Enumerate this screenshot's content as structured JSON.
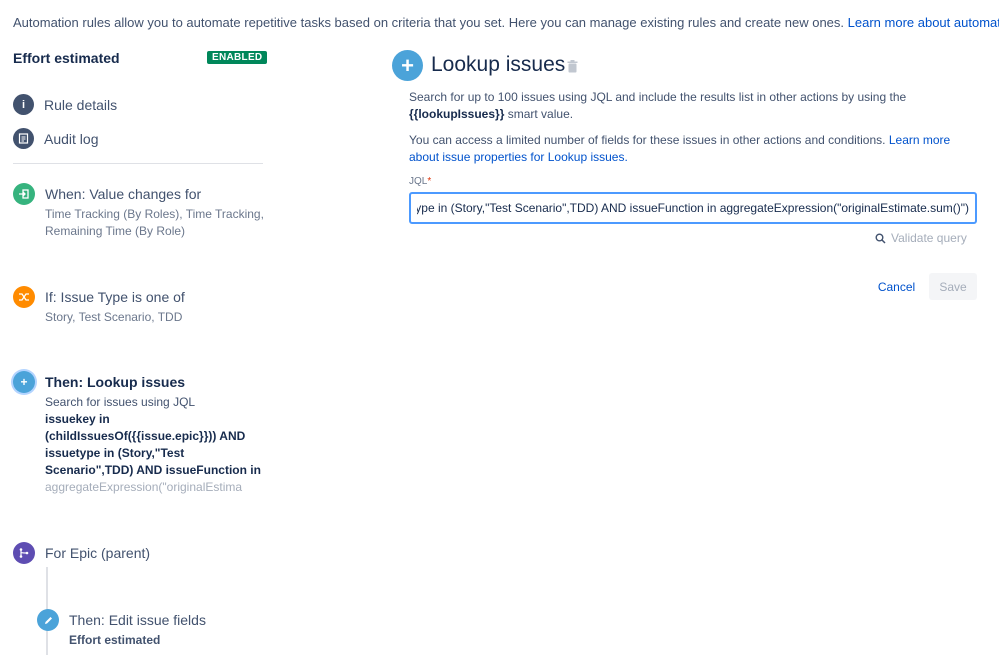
{
  "intro": {
    "text": "Automation rules allow you to automate repetitive tasks based on criteria that you set. Here you can manage existing rules and create new ones.",
    "link": "Learn more about automation"
  },
  "rule": {
    "name": "Effort estimated",
    "status": "ENABLED"
  },
  "nav": [
    {
      "label": "Rule details",
      "icon": "info-icon"
    },
    {
      "label": "Audit log",
      "icon": "list-icon"
    }
  ],
  "steps": {
    "trigger": {
      "title": "When: Value changes for",
      "desc": "Time Tracking (By Roles), Time Tracking, Remaining Time (By Role)",
      "color": "#36b37e"
    },
    "condition": {
      "title": "If: Issue Type is one of",
      "desc": "Story, Test Scenario, TDD",
      "color": "#ff8b00"
    },
    "action": {
      "title": "Then: Lookup issues",
      "desc": "Search for issues using JQL",
      "jql_preview": "issuekey in (childIssuesOf({{issue.epic}})) AND issuetype in (Story,\"Test Scenario\",TDD) AND issueFunction in",
      "jql_fade": "aggregateExpression(\"originalEstima",
      "color": "#4ba3d9"
    },
    "branch": {
      "title": "For Epic (parent)",
      "color": "#5e4db2"
    },
    "edit": {
      "title": "Then: Edit issue fields",
      "desc": "Effort estimated",
      "color": "#4ba3d9"
    }
  },
  "panel": {
    "title": "Lookup issues",
    "desc1_pre": "Search for up to 100 issues using JQL and include the results list in other actions by using the",
    "desc1_code": "{{lookupIssues}}",
    "desc1_post": "smart value.",
    "desc2": "You can access a limited number of fields for these issues in other actions and conditions.",
    "desc2_link": "Learn more about issue properties for Lookup issues.",
    "jql_label": "JQL",
    "jql_value": "issuekey in (childIssuesOf({{issue.epic}})) AND issuetype in (Story,\"Test Scenario\",TDD) AND issueFunction in aggregateExpression(\"originalEstimate.sum()\")",
    "validate_label": "Validate query",
    "cancel_label": "Cancel",
    "save_label": "Save"
  }
}
